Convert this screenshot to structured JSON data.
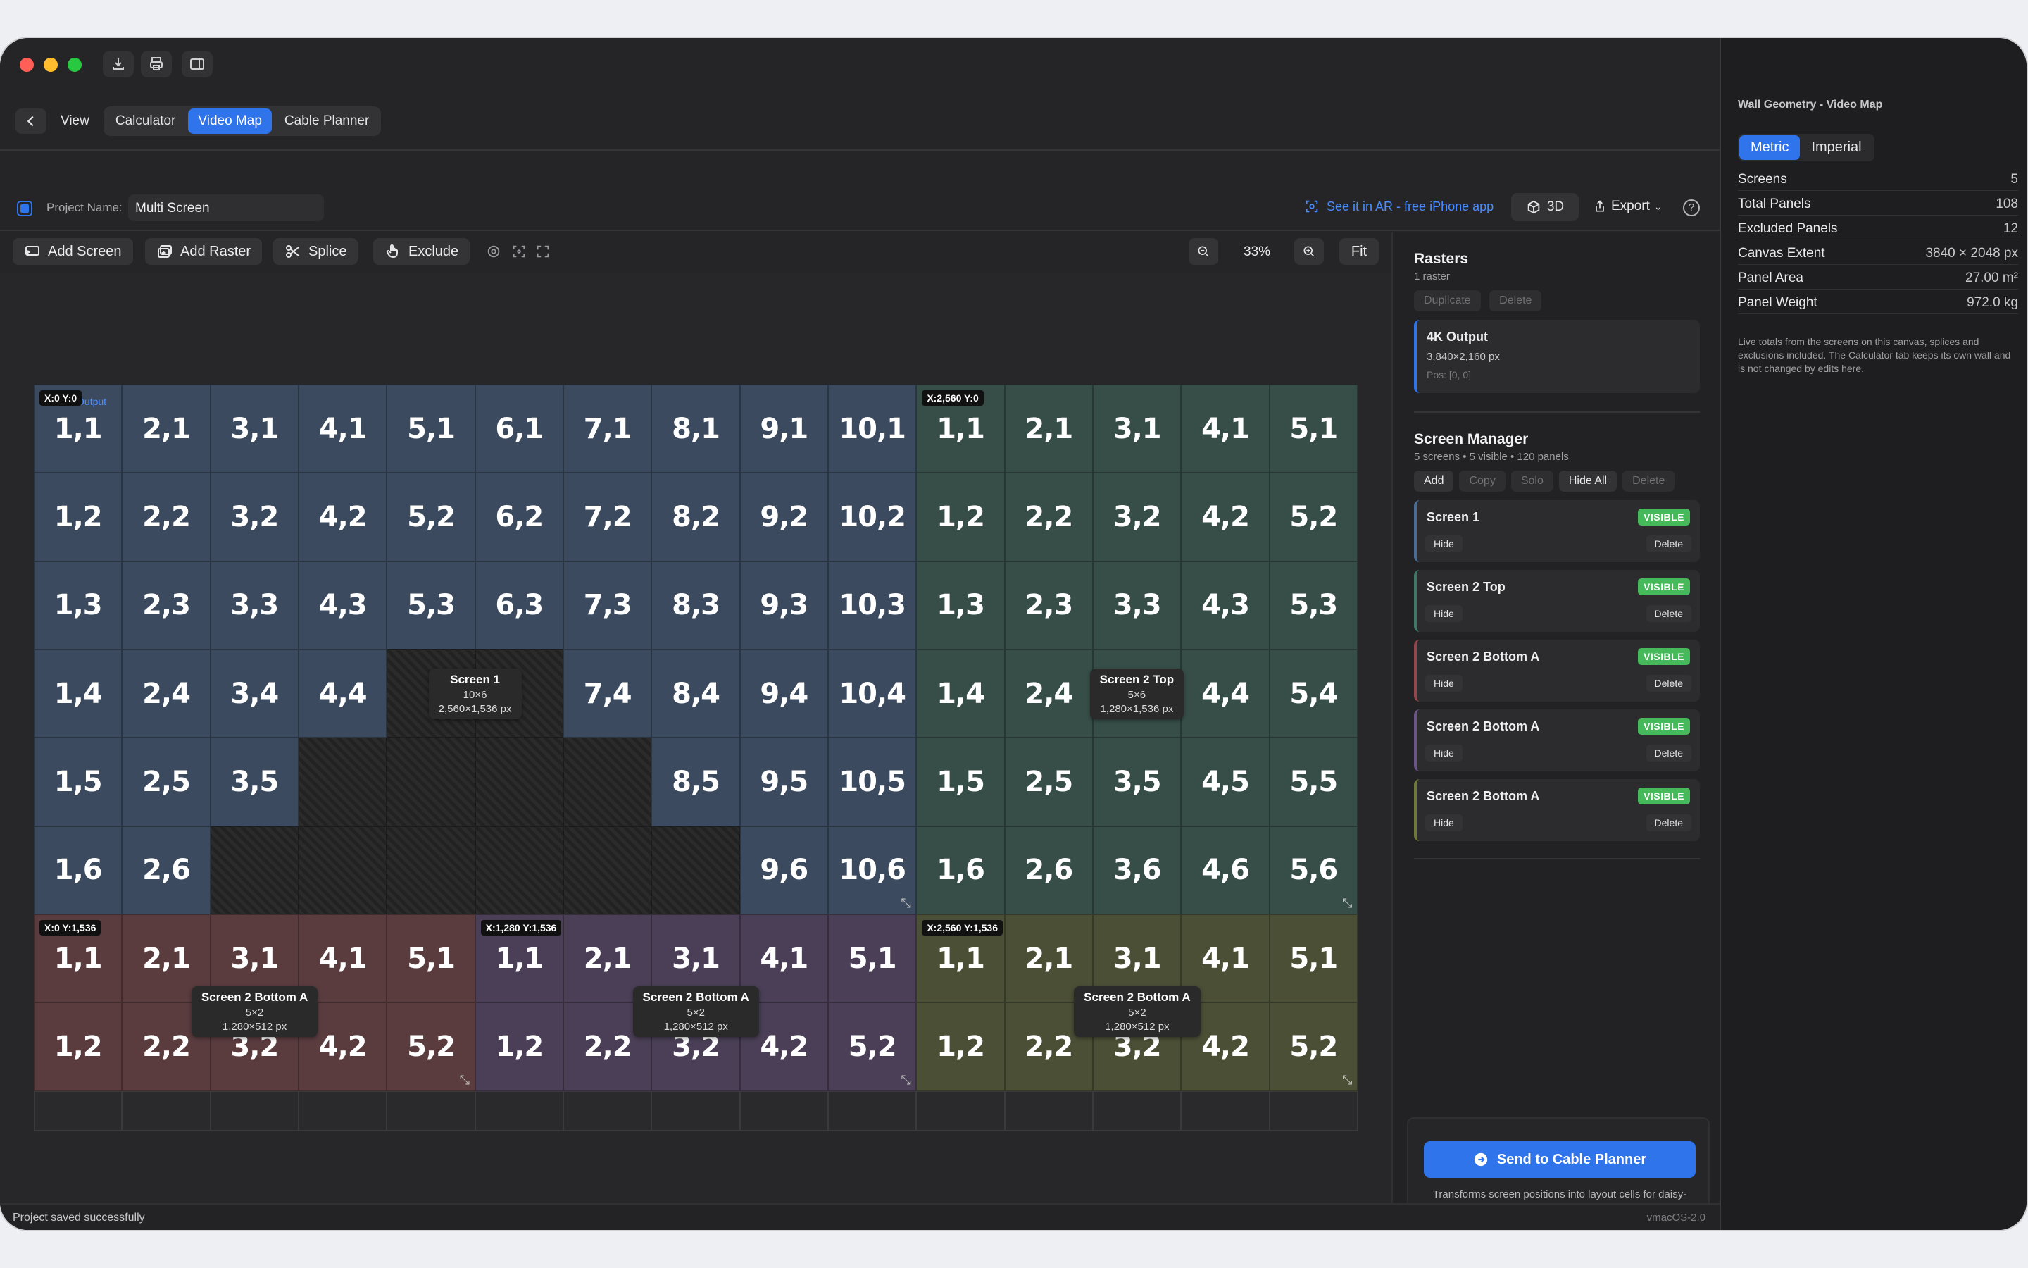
{
  "nav": {
    "view_label": "View",
    "tabs": [
      {
        "label": "Calculator",
        "active": false
      },
      {
        "label": "Video Map",
        "active": true
      },
      {
        "label": "Cable Planner",
        "active": false
      }
    ]
  },
  "project": {
    "label": "Project Name:",
    "value": "Multi Screen",
    "ar_link": "See it in AR - free iPhone app",
    "btn_3d": "3D",
    "export": "Export",
    "help": "?"
  },
  "toolbar": {
    "add_screen": "Add Screen",
    "add_raster": "Add Raster",
    "splice": "Splice",
    "exclude": "Exclude",
    "zoom": "33%",
    "fit": "Fit"
  },
  "canvas": {
    "raster_label": "4K Output",
    "coords": [
      "X:0 Y:0",
      "X:2,560 Y:0",
      "X:0 Y:1,536",
      "X:1,280 Y:1,536",
      "X:2,560 Y:1,536"
    ],
    "screens": [
      {
        "name": "Screen 1",
        "size": "10×6",
        "px": "2,560×1,536 px",
        "color": "#3b4a5e"
      },
      {
        "name": "Screen 2 Top",
        "size": "5×6",
        "px": "1,280×1,536 px",
        "color": "#374e48"
      },
      {
        "name": "Screen 2 Bottom A",
        "size": "5×2",
        "px": "1,280×512 px",
        "color": "#5a3c3f"
      },
      {
        "name": "Screen 2 Bottom A",
        "size": "5×2",
        "px": "1,280×512 px",
        "color": "#4a3f56"
      },
      {
        "name": "Screen 2 Bottom A",
        "size": "5×2",
        "px": "1,280×512 px",
        "color": "#4a4f36"
      }
    ],
    "screen1_excluded": [
      "5,4",
      "6,4",
      "4,5",
      "5,5",
      "6,5",
      "7,5",
      "3,6",
      "4,6",
      "5,6",
      "6,6",
      "7,6",
      "8,6"
    ]
  },
  "rasters": {
    "title": "Rasters",
    "sub": "1 raster",
    "duplicate": "Duplicate",
    "delete": "Delete",
    "item": {
      "name": "4K Output",
      "res": "3,840×2,160 px",
      "pos": "Pos: [0, 0]"
    }
  },
  "manager": {
    "title": "Screen Manager",
    "sub": "5 screens • 5 visible • 120 panels",
    "buttons": [
      "Add",
      "Copy",
      "Solo",
      "Hide All",
      "Delete"
    ],
    "items": [
      {
        "name": "Screen 1",
        "status": "VISIBLE",
        "hide": "Hide",
        "delete": "Delete",
        "color": "#4a6d96"
      },
      {
        "name": "Screen 2 Top",
        "status": "VISIBLE",
        "hide": "Hide",
        "delete": "Delete",
        "color": "#3f7866"
      },
      {
        "name": "Screen 2 Bottom A",
        "status": "VISIBLE",
        "hide": "Hide",
        "delete": "Delete",
        "color": "#93474d"
      },
      {
        "name": "Screen 2 Bottom A",
        "status": "VISIBLE",
        "hide": "Hide",
        "delete": "Delete",
        "color": "#6b5487"
      },
      {
        "name": "Screen 2 Bottom A",
        "status": "VISIBLE",
        "hide": "Hide",
        "delete": "Delete",
        "color": "#6f7a3a"
      }
    ]
  },
  "cable": {
    "button": "Send to Cable Planner",
    "note": "Transforms screen positions into layout cells for daisy-chain cable planning."
  },
  "status": {
    "left": "Project saved successfully",
    "right": "vmacOS-2.0"
  },
  "inspector": {
    "title": "Wall Geometry - Video Map",
    "units": [
      {
        "label": "Metric",
        "active": true
      },
      {
        "label": "Imperial",
        "active": false
      }
    ],
    "stats": [
      {
        "k": "Screens",
        "v": "5"
      },
      {
        "k": "Total Panels",
        "v": "108"
      },
      {
        "k": "Excluded Panels",
        "v": "12"
      },
      {
        "k": "Canvas Extent",
        "v": "3840 × 2048 px"
      },
      {
        "k": "Panel Area",
        "v": "27.00 m²"
      },
      {
        "k": "Panel Weight",
        "v": "972.0 kg"
      }
    ],
    "note": "Live totals from the screens on this canvas, splices and exclusions included. The Calculator tab keeps its own wall and is not changed by edits here."
  }
}
